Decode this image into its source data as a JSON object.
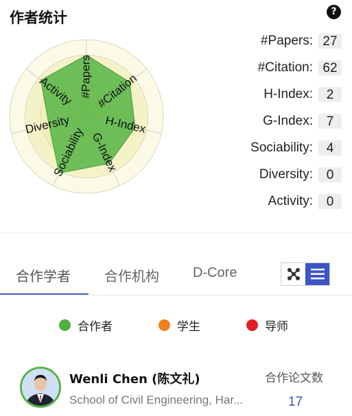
{
  "header": {
    "title": "作者统计",
    "help_icon": "?"
  },
  "radar": {
    "axes": [
      "#Papers",
      "#Citation",
      "H-Index",
      "G-Index",
      "Sociability",
      "Diversity",
      "Activity"
    ],
    "values": [
      0.8,
      0.72,
      0.65,
      0.68,
      0.82,
      0.5,
      0.76
    ],
    "colors": {
      "fill": "#5fb84e",
      "rings": "#f3efb8",
      "outer": "#fbfae6"
    }
  },
  "stats": [
    {
      "label": "#Papers:",
      "value": "27"
    },
    {
      "label": "#Citation:",
      "value": "62"
    },
    {
      "label": "H-Index:",
      "value": "2"
    },
    {
      "label": "G-Index:",
      "value": "7"
    },
    {
      "label": "Sociability:",
      "value": "4"
    },
    {
      "label": "Diversity:",
      "value": "0"
    },
    {
      "label": "Activity:",
      "value": "0"
    }
  ],
  "tabs": [
    {
      "label": "合作学者",
      "active": true
    },
    {
      "label": "合作机构",
      "active": false
    },
    {
      "label": "D-Core",
      "active": false
    }
  ],
  "view_toggle": {
    "graph_icon": "graph-view-icon",
    "list_icon": "list-view-icon",
    "active": "list",
    "accent": "#3b55c6"
  },
  "legend": [
    {
      "label": "合作者",
      "color": "#4caf40"
    },
    {
      "label": "学生",
      "color": "#f08020"
    },
    {
      "label": "导师",
      "color": "#e02020"
    }
  ],
  "coauthor": {
    "name": "Wenli Chen (陈文礼)",
    "affiliation": "School of Civil Engineering, Har...",
    "count_label": "合作论文数",
    "count": "17"
  }
}
